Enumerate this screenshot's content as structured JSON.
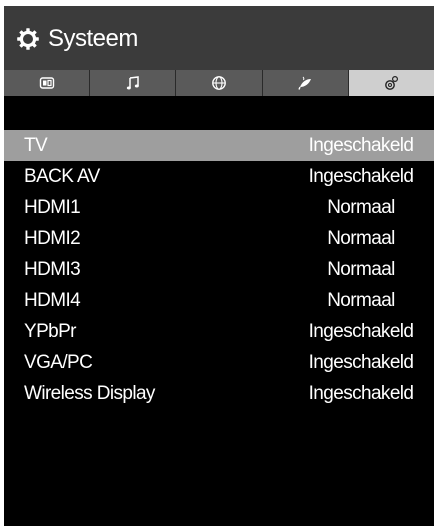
{
  "header": {
    "title": "Systeem",
    "icon": "gear-icon"
  },
  "tabs": [
    {
      "icon": "picture-icon",
      "active": false
    },
    {
      "icon": "music-note-icon",
      "active": false
    },
    {
      "icon": "globe-icon",
      "active": false
    },
    {
      "icon": "satellite-icon",
      "active": false
    },
    {
      "icon": "settings-icon",
      "active": true
    }
  ],
  "list": {
    "selected_index": 0,
    "items": [
      {
        "label": "TV",
        "value": "Ingeschakeld"
      },
      {
        "label": "BACK AV",
        "value": "Ingeschakeld"
      },
      {
        "label": "HDMI1",
        "value": "Normaal"
      },
      {
        "label": "HDMI2",
        "value": "Normaal"
      },
      {
        "label": "HDMI3",
        "value": "Normaal"
      },
      {
        "label": "HDMI4",
        "value": "Normaal"
      },
      {
        "label": "YPbPr",
        "value": "Ingeschakeld"
      },
      {
        "label": "VGA/PC",
        "value": "Ingeschakeld"
      },
      {
        "label": "Wireless Display",
        "value": "Ingeschakeld"
      }
    ]
  },
  "colors": {
    "background": "#000000",
    "header": "#3b3b3b",
    "tabbar": "#5a5a5a",
    "active_tab": "#cfcfcf",
    "selected_row": "#9e9e9e",
    "text": "#ffffff"
  }
}
